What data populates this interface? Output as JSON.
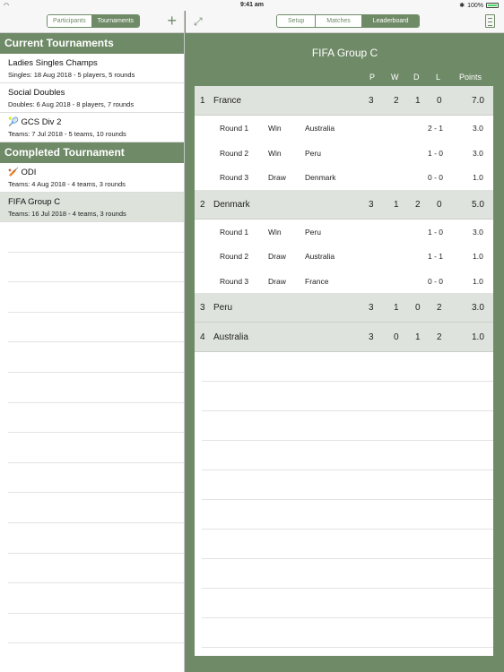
{
  "status_bar": {
    "time": "9:41 am",
    "battery": "100%",
    "bluetooth": "✱"
  },
  "left_nav": {
    "tabs": [
      {
        "label": "Participants",
        "active": false
      },
      {
        "label": "Tournaments",
        "active": true
      }
    ],
    "add_icon": "+"
  },
  "sections": [
    {
      "title": "Current Tournaments",
      "items": [
        {
          "title": "Ladies Singles Champs",
          "subtitle": "Singles: 18 Aug 2018 - 5 players, 5 rounds",
          "icon": ""
        },
        {
          "title": "Social Doubles",
          "subtitle": "Doubles: 6 Aug 2018 - 8 players, 7 rounds",
          "icon": ""
        },
        {
          "title": "GCS Div 2",
          "subtitle": "Teams: 7 Jul 2018 - 5 teams, 10 rounds",
          "icon": "🎾"
        }
      ]
    },
    {
      "title": "Completed Tournament",
      "items": [
        {
          "title": "ODI",
          "subtitle": "Teams: 4 Aug 2018 - 4 teams, 3 rounds",
          "icon": "🏏"
        },
        {
          "title": "FIFA Group C",
          "subtitle": "Teams: 16 Jul 2018 - 4 teams, 3 rounds",
          "icon": "",
          "selected": true
        }
      ]
    }
  ],
  "right_nav": {
    "tabs": [
      {
        "label": "Setup",
        "active": false
      },
      {
        "label": "Matches",
        "active": false
      },
      {
        "label": "Leaderboard",
        "active": true
      }
    ]
  },
  "leaderboard": {
    "title": "FIFA Group C",
    "columns": {
      "p": "P",
      "w": "W",
      "d": "D",
      "l": "L",
      "points": "Points"
    },
    "teams": [
      {
        "rank": "1",
        "name": "France",
        "p": "3",
        "w": "2",
        "d": "1",
        "l": "0",
        "points": "7.0",
        "rounds": [
          {
            "round": "Round 1",
            "result": "Win",
            "opponent": "Australia",
            "score": "2 - 1",
            "points": "3.0"
          },
          {
            "round": "Round 2",
            "result": "Win",
            "opponent": "Peru",
            "score": "1 - 0",
            "points": "3.0"
          },
          {
            "round": "Round 3",
            "result": "Draw",
            "opponent": "Denmark",
            "score": "0 - 0",
            "points": "1.0"
          }
        ]
      },
      {
        "rank": "2",
        "name": "Denmark",
        "p": "3",
        "w": "1",
        "d": "2",
        "l": "0",
        "points": "5.0",
        "rounds": [
          {
            "round": "Round 1",
            "result": "Win",
            "opponent": "Peru",
            "score": "1 - 0",
            "points": "3.0"
          },
          {
            "round": "Round 2",
            "result": "Draw",
            "opponent": "Australia",
            "score": "1 - 1",
            "points": "1.0"
          },
          {
            "round": "Round 3",
            "result": "Draw",
            "opponent": "France",
            "score": "0 - 0",
            "points": "1.0"
          }
        ]
      },
      {
        "rank": "3",
        "name": "Peru",
        "p": "3",
        "w": "1",
        "d": "0",
        "l": "2",
        "points": "3.0",
        "rounds": []
      },
      {
        "rank": "4",
        "name": "Australia",
        "p": "3",
        "w": "0",
        "d": "1",
        "l": "2",
        "points": "1.0",
        "rounds": []
      }
    ]
  }
}
